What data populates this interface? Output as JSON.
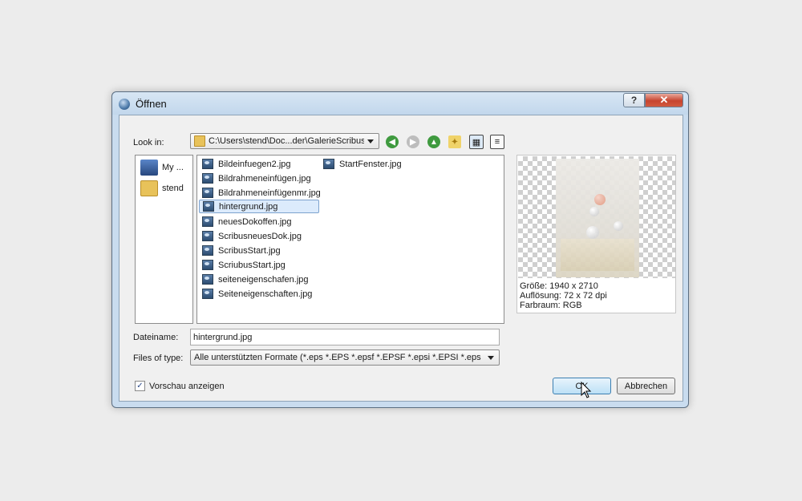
{
  "window": {
    "title": "Öffnen",
    "help_label": "?",
    "close_label": "✕"
  },
  "look_in": {
    "label": "Look in:",
    "path": "C:\\Users\\stend\\Doc...der\\GalerieScribus"
  },
  "sidebar": {
    "items": [
      {
        "label": "My ...",
        "icon": "computer-icon"
      },
      {
        "label": "stend",
        "icon": "user-folder-icon"
      }
    ]
  },
  "files": [
    "Bildeinfuegen2.jpg",
    "Bildrahmeneinfügen.jpg",
    "Bildrahmeneinfügenmr.jpg",
    "hintergrund.jpg",
    "neuesDokoffen.jpg",
    "ScribusneuesDok.jpg",
    "ScribusStart.jpg",
    "ScriubusStart.jpg",
    "seiteneigenschafen.jpg",
    "Seiteneigenschaften.jpg",
    "StartFenster.jpg"
  ],
  "selected_file": "hintergrund.jpg",
  "preview": {
    "size": "Größe: 1940 x 2710",
    "resolution": "Auflösung: 72 x 72 dpi",
    "color_space": "Farbraum: RGB"
  },
  "filename": {
    "label": "Dateiname:",
    "value": "hintergrund.jpg"
  },
  "filetype": {
    "label": "Files of type:",
    "value": "Alle unterstützten Formate (*.eps *.EPS *.epsf *.EPSF *.epsi *.EPSI *.eps"
  },
  "show_preview": {
    "label": "Vorschau anzeigen",
    "checked": true,
    "check_mark": "✓"
  },
  "buttons": {
    "ok": "OK",
    "cancel": "Abbrechen"
  },
  "toolbar_icons": [
    "back-icon",
    "forward-icon",
    "up-icon",
    "new-folder-icon",
    "detail-view-icon",
    "list-view-icon"
  ]
}
